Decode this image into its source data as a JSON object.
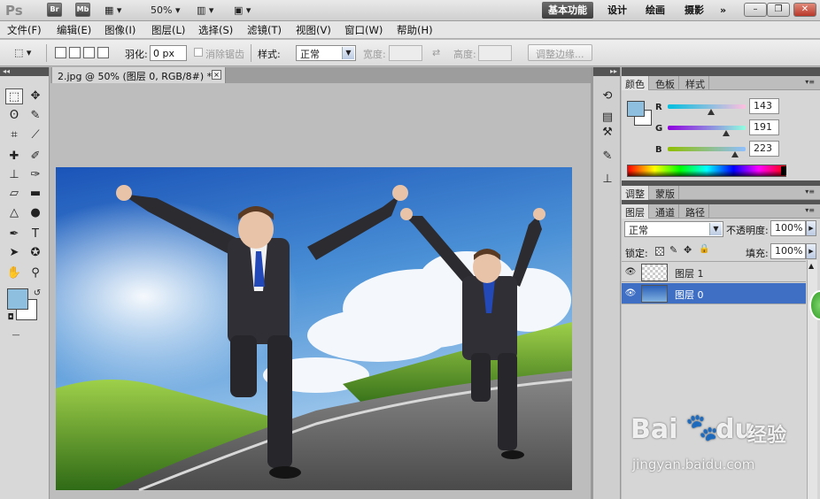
{
  "appbar": {
    "logo": "Ps",
    "icons": [
      "Br",
      "Mb"
    ],
    "zoom": "50%",
    "workspaces": [
      "基本功能",
      "设计",
      "绘画",
      "摄影"
    ],
    "more": "»"
  },
  "menu": [
    "文件(F)",
    "编辑(E)",
    "图像(I)",
    "图层(L)",
    "选择(S)",
    "滤镜(T)",
    "视图(V)",
    "窗口(W)",
    "帮助(H)"
  ],
  "options": {
    "feather_label": "羽化:",
    "feather_value": "0 px",
    "antialias_label": "消除锯齿",
    "style_label": "样式:",
    "style_value": "正常",
    "width_label": "宽度:",
    "height_label": "高度:",
    "refine_label": "调整边缘..."
  },
  "document": {
    "tab_title": "2.jpg @ 50% (图层 0, RGB/8#) *",
    "close": "×"
  },
  "color_panel": {
    "tabs": [
      "颜色",
      "色板",
      "样式"
    ],
    "channels": [
      {
        "name": "R",
        "value": "143"
      },
      {
        "name": "G",
        "value": "191"
      },
      {
        "name": "B",
        "value": "223"
      }
    ],
    "foreground": "#8fbfdf"
  },
  "adjust_panel": {
    "tabs": [
      "调整",
      "蒙版"
    ]
  },
  "layers_panel": {
    "tabs": [
      "图层",
      "通道",
      "路径"
    ],
    "blend_mode": "正常",
    "opacity_label": "不透明度:",
    "opacity_value": "100%",
    "lock_label": "锁定:",
    "fill_label": "填充:",
    "fill_value": "100%",
    "layers": [
      {
        "name": "图层 1",
        "selected": false
      },
      {
        "name": "图层 0",
        "selected": true
      }
    ]
  },
  "watermark": {
    "brand": "Bai",
    "brand2": "du",
    "cn": "经验",
    "url": "jingyan.baidu.com"
  }
}
